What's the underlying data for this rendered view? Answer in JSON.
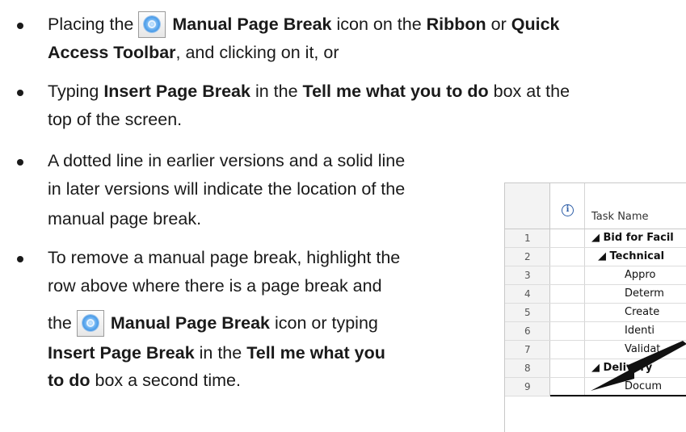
{
  "bullets": [
    {
      "parts": [
        {
          "t": "Placing the ",
          "b": false
        },
        {
          "icon": "manual-page-break-icon"
        },
        {
          "t": " Manual Page Break",
          "b": true
        },
        {
          "t": " icon on the ",
          "b": false
        },
        {
          "t": "Ribbon",
          "b": true
        },
        {
          "t": " or ",
          "b": false
        },
        {
          "t": "Quick",
          "b": true
        }
      ],
      "line2": [
        {
          "t": "Access Toolbar",
          "b": true
        },
        {
          "t": ", and clicking on it, or",
          "b": false
        }
      ]
    }
  ],
  "b1": {
    "l1_a": "Placing the ",
    "l1_b": " Manual Page Break",
    "l1_c": " icon on the ",
    "l1_d": "Ribbon",
    "l1_e": " or ",
    "l1_f": "Quick",
    "l2_a": "Access Toolbar",
    "l2_b": ", and clicking on it, or"
  },
  "b2": {
    "l1_a": "Typing ",
    "l1_b": "Insert Page Break",
    "l1_c": " in the ",
    "l1_d": "Tell me what you to do",
    "l1_e": " box at the",
    "l2": "top of the screen."
  },
  "b3": {
    "l1": "A dotted line in earlier versions and a solid line",
    "l2": "in later versions will indicate the location of the",
    "l3": "manual page break."
  },
  "b4": {
    "l1": "To remove a manual page break, highlight the",
    "l2": "row above where there is a page break and",
    "l3_a": "the ",
    "l3_b": " Manual Page Break",
    "l3_c": " icon or typing",
    "l4_a": "Insert Page Break",
    "l4_b": " in the ",
    "l4_c": "Tell me what you",
    "l5_a": "to do",
    "l5_b": " box a second time."
  },
  "table": {
    "header": "Task Name",
    "info_symbol": "i",
    "rows": [
      {
        "num": "1",
        "name": "◢ Bid for Facil",
        "bold": true
      },
      {
        "num": "2",
        "name": "◢ Technical",
        "bold": true
      },
      {
        "num": "3",
        "name": "Appro",
        "bold": false
      },
      {
        "num": "4",
        "name": "Determ",
        "bold": false
      },
      {
        "num": "5",
        "name": "Create",
        "bold": false
      },
      {
        "num": "6",
        "name": "Identi",
        "bold": false
      },
      {
        "num": "7",
        "name": "Validat",
        "bold": false
      },
      {
        "num": "8",
        "name": "◢ Delivery",
        "bold": true
      },
      {
        "num": "9",
        "name": "Docum",
        "bold": false
      }
    ]
  },
  "colors": {
    "text": "#1a1a1a",
    "break_line": "#000000",
    "icon_blue": "#2a7fd4"
  }
}
